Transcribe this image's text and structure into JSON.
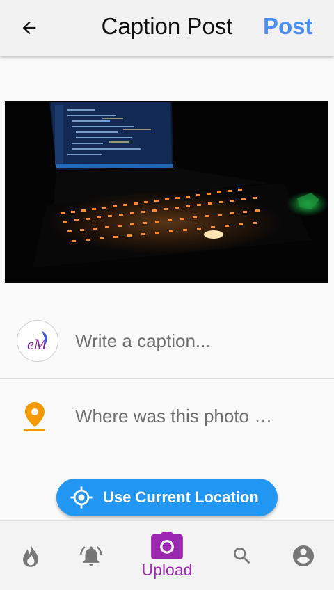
{
  "app_bar": {
    "title": "Caption Post",
    "post_label": "Post",
    "back_icon": "arrow-left-icon"
  },
  "photo": {
    "description_icon": "laptop-photo"
  },
  "caption": {
    "placeholder": "Write a caption...",
    "value": "",
    "avatar_text": "eM"
  },
  "location": {
    "placeholder": "Where was this photo …",
    "value": "",
    "icon": "location-pin-icon"
  },
  "use_location_button": {
    "label": "Use Current Location",
    "icon": "crosshair-icon"
  },
  "bottom_nav": {
    "items": [
      {
        "icon": "flame-icon",
        "label": "",
        "active": false
      },
      {
        "icon": "bell-icon",
        "label": "",
        "active": false
      },
      {
        "icon": "camera-icon",
        "label": "Upload",
        "active": true
      },
      {
        "icon": "search-icon",
        "label": "",
        "active": false
      },
      {
        "icon": "account-icon",
        "label": "",
        "active": false
      }
    ]
  },
  "colors": {
    "accent_blue": "#4b8ef5",
    "button_blue": "#2196f3",
    "active_purple": "#9c27b0",
    "pin_orange": "#f59b00",
    "inactive_gray": "#777777"
  }
}
